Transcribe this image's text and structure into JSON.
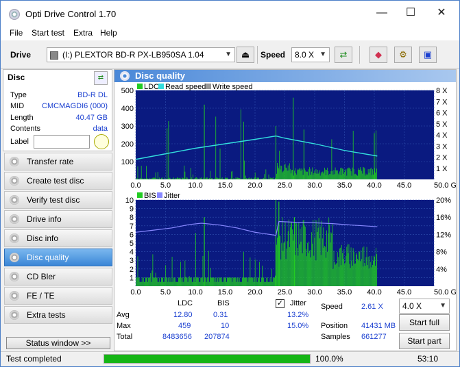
{
  "window": {
    "title": "Opti Drive Control 1.70",
    "minimize": "—",
    "maximize": "☐",
    "close": "✕"
  },
  "menu": [
    "File",
    "Start test",
    "Extra",
    "Help"
  ],
  "toolbar": {
    "drive_label": "Drive",
    "drive_value": "(I:)  PLEXTOR BD-R  PX-LB950SA 1.04",
    "speed_label": "Speed",
    "speed_value": "8.0 X"
  },
  "disc": {
    "header": "Disc",
    "type_label": "Type",
    "type_value": "BD-R DL",
    "mid_label": "MID",
    "mid_value": "CMCMAGDI6 (000)",
    "length_label": "Length",
    "length_value": "40.47 GB",
    "contents_label": "Contents",
    "contents_value": "data",
    "label_label": "Label",
    "label_value": ""
  },
  "nav": [
    {
      "label": "Transfer rate",
      "active": false
    },
    {
      "label": "Create test disc",
      "active": false
    },
    {
      "label": "Verify test disc",
      "active": false
    },
    {
      "label": "Drive info",
      "active": false
    },
    {
      "label": "Disc info",
      "active": false
    },
    {
      "label": "Disc quality",
      "active": true
    },
    {
      "label": "CD Bler",
      "active": false
    },
    {
      "label": "FE / TE",
      "active": false
    },
    {
      "label": "Extra tests",
      "active": false
    }
  ],
  "status_window_label": "Status window >>",
  "panel_title": "Disc quality",
  "chart_data": [
    {
      "type": "bar",
      "legend": [
        "LDC",
        "Read speed",
        "Write speed"
      ],
      "colors": {
        "LDC": "#22cc22",
        "Read speed": "#33dddd",
        "Write speed": "#999999",
        "background": "#0a1a80"
      },
      "x_ticks": [
        "0.0",
        "5.0",
        "10.0",
        "15.0",
        "20.0",
        "25.0",
        "30.0",
        "35.0",
        "40.0",
        "45.0",
        "50.0 GB"
      ],
      "y_left_ticks": [
        "500",
        "400",
        "300",
        "200",
        "100"
      ],
      "y_right_ticks": [
        "8 X",
        "7 X",
        "6 X",
        "5 X",
        "4 X",
        "3 X",
        "2 X",
        "1 X"
      ],
      "xlim": [
        0,
        50
      ],
      "ylim": [
        0,
        500
      ],
      "read_speed": {
        "x": [
          0,
          5,
          10,
          15,
          20,
          23.5,
          25,
          30,
          35,
          40.5
        ],
        "y": [
          1.8,
          2.3,
          2.8,
          3.2,
          3.6,
          3.9,
          3.7,
          3.2,
          2.6,
          2.1
        ]
      }
    },
    {
      "type": "bar",
      "legend": [
        "BIS",
        "Jitter"
      ],
      "colors": {
        "BIS": "#22cc22",
        "Jitter": "#8888ff",
        "background": "#0a1a80"
      },
      "x_ticks": [
        "0.0",
        "5.0",
        "10.0",
        "15.0",
        "20.0",
        "25.0",
        "30.0",
        "35.0",
        "40.0",
        "45.0",
        "50.0 GB"
      ],
      "y_left_ticks": [
        "10",
        "9",
        "8",
        "7",
        "6",
        "5",
        "4",
        "3",
        "2",
        "1"
      ],
      "y_right_ticks": [
        "20%",
        "16%",
        "12%",
        "8%",
        "4%"
      ],
      "xlim": [
        0,
        50
      ],
      "ylim": [
        0,
        10
      ],
      "jitter": {
        "x": [
          0,
          3,
          6,
          9,
          11,
          14,
          17,
          20,
          23.5,
          24,
          27,
          30,
          33,
          36,
          40.5
        ],
        "y": [
          12.5,
          13.0,
          13.5,
          14.3,
          14.6,
          14.2,
          13.5,
          12.5,
          11.8,
          15.0,
          14.8,
          14.7,
          14.5,
          14.2,
          13.8
        ]
      }
    }
  ],
  "stats": {
    "col_ldc": "LDC",
    "col_bis": "BIS",
    "avg_label": "Avg",
    "avg_ldc": "12.80",
    "avg_bis": "0.31",
    "max_label": "Max",
    "max_ldc": "459",
    "max_bis": "10",
    "total_label": "Total",
    "total_ldc": "8483656",
    "total_bis": "207874",
    "jitter_label": "Jitter",
    "jitter_avg": "13.2%",
    "jitter_max": "15.0%",
    "speed_label": "Speed",
    "speed_value": "2.61 X",
    "position_label": "Position",
    "position_value": "41431 MB",
    "samples_label": "Samples",
    "samples_value": "661277",
    "speed_select": "4.0 X",
    "start_full": "Start full",
    "start_part": "Start part"
  },
  "status": {
    "text": "Test completed",
    "progress_text": "100.0%",
    "progress": 1.0,
    "time": "53:10"
  }
}
